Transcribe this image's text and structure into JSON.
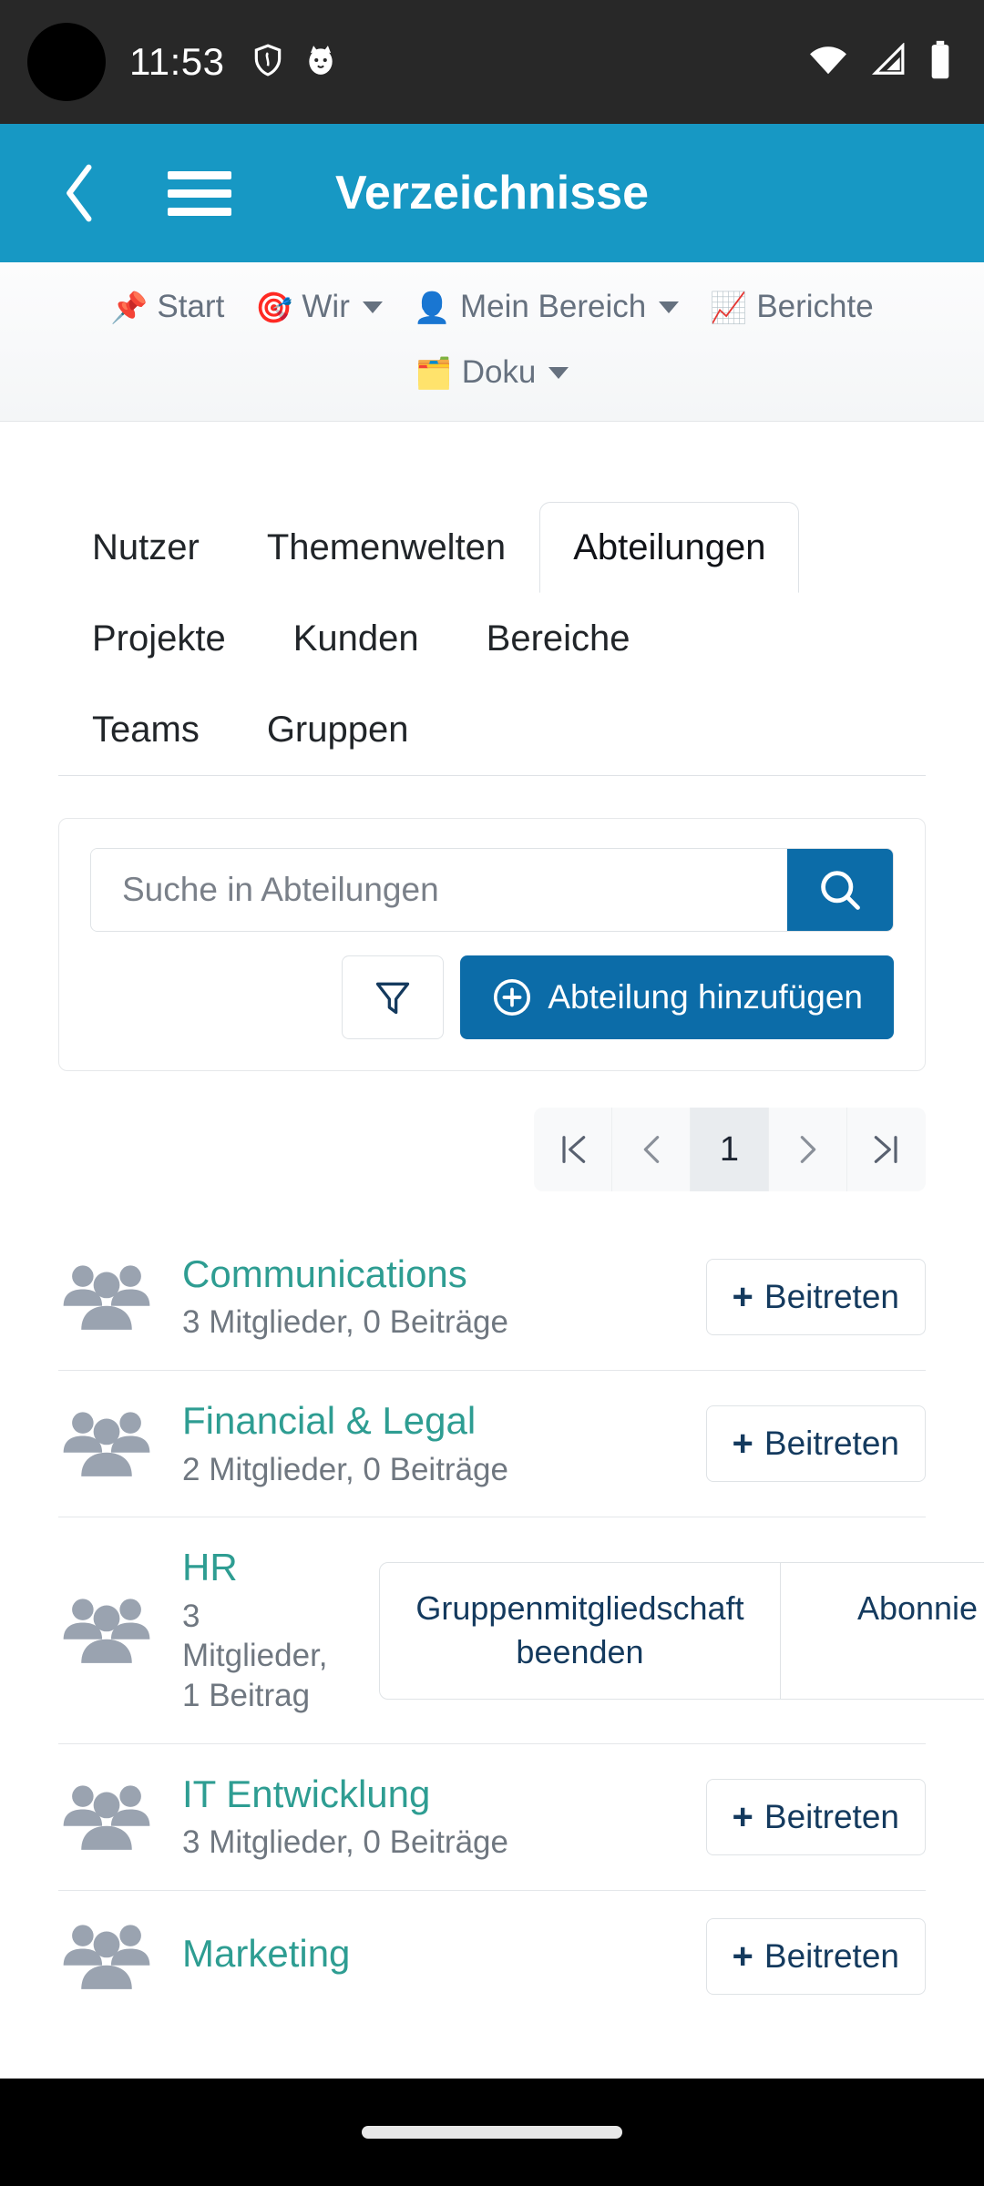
{
  "status_bar": {
    "time": "11:53",
    "left_icons": [
      "shield-icon",
      "cat-face-icon"
    ],
    "right_icons": [
      "wifi-icon",
      "cellular-signal-icon",
      "battery-icon"
    ]
  },
  "header": {
    "title": "Verzeichnisse",
    "back_icon": "chevron-left-icon",
    "menu_icon": "hamburger-menu-icon",
    "background_color": "#1798c4"
  },
  "topnav": {
    "items": [
      {
        "label": "Start",
        "emoji": "📌",
        "icon": "pushpin-icon",
        "has_caret": false
      },
      {
        "label": "Wir",
        "emoji": "🎯",
        "icon": "target-icon",
        "has_caret": true
      },
      {
        "label": "Mein Bereich",
        "emoji": "👤",
        "icon": "person-icon",
        "has_caret": true
      },
      {
        "label": "Berichte",
        "emoji": "📈",
        "icon": "chart-increasing-icon",
        "has_caret": false
      },
      {
        "label": "Doku",
        "emoji": "🗂️",
        "icon": "card-index-dividers-icon",
        "has_caret": true
      }
    ]
  },
  "tabs": {
    "items": [
      {
        "label": "Nutzer",
        "active": false
      },
      {
        "label": "Themenwelten",
        "active": false
      },
      {
        "label": "Abteilungen",
        "active": true
      },
      {
        "label": "Projekte",
        "active": false
      },
      {
        "label": "Kunden",
        "active": false
      },
      {
        "label": "Bereiche",
        "active": false
      },
      {
        "label": "Teams",
        "active": false
      },
      {
        "label": "Gruppen",
        "active": false
      }
    ]
  },
  "search": {
    "placeholder": "Suche in Abteilungen",
    "value": "",
    "search_icon": "magnifying-glass-icon",
    "filter_icon": "funnel-filter-icon",
    "add_button_label": "Abteilung hinzufügen",
    "add_button_icon": "plus-circle-icon",
    "accent_color": "#0c6ca8"
  },
  "pagination": {
    "first_label": "|‹",
    "prev_label": "‹",
    "current_page": "1",
    "next_label": "›",
    "last_label": "›|"
  },
  "list": {
    "group_icon": "people-group-icon",
    "join_label": "Beitreten",
    "join_icon": "plus-icon",
    "items": [
      {
        "name": "Communications",
        "meta": "3 Mitglieder, 0 Beiträge",
        "state": "join"
      },
      {
        "name": "Financial & Legal",
        "meta": "2 Mitglieder, 0 Beiträge",
        "state": "join"
      },
      {
        "name": "HR",
        "meta": "3 Mitglieder, 1 Beitrag",
        "state": "member",
        "actions": [
          "Gruppenmitgliedschaft beenden",
          "Abonnie"
        ]
      },
      {
        "name": "IT Entwicklung",
        "meta": "3 Mitglieder, 0 Beiträge",
        "state": "join"
      },
      {
        "name": "Marketing",
        "meta": "",
        "state": "join"
      }
    ]
  },
  "colors": {
    "header_blue": "#1798c4",
    "link_teal": "#2e9d92",
    "button_blue": "#0c6ca8",
    "dark_navy_text": "#143a5e",
    "muted_text": "#6f7780"
  }
}
